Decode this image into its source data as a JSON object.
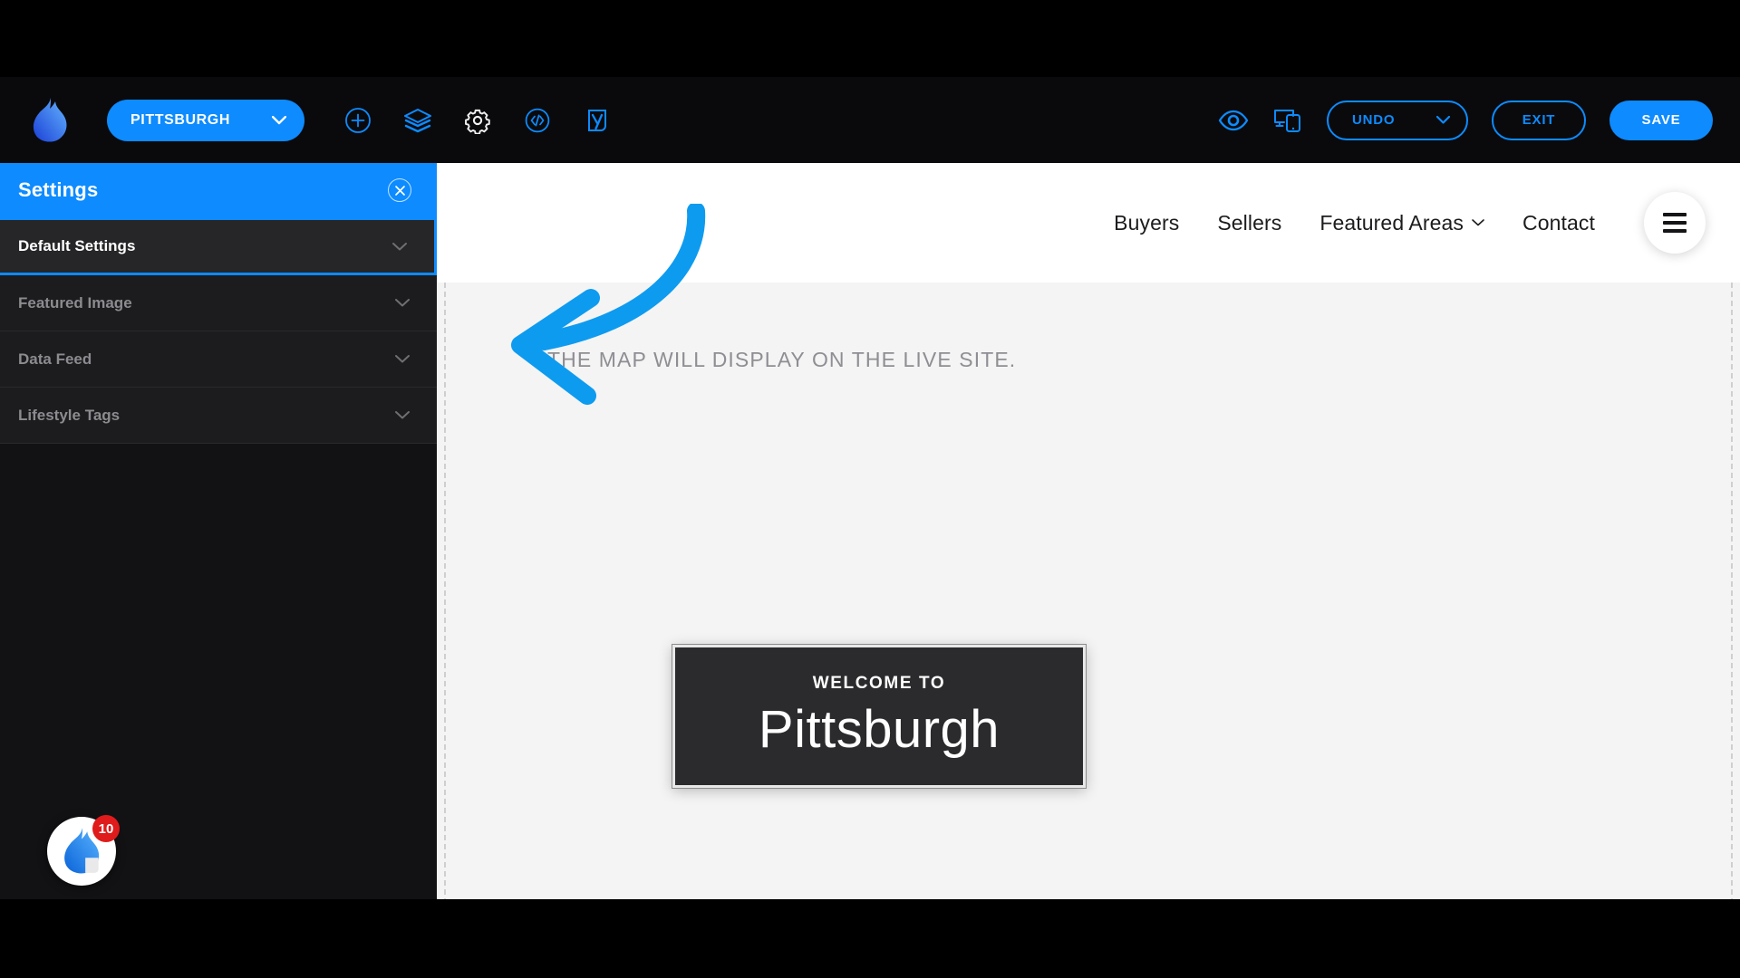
{
  "app": {
    "logo_icon": "flame-logo",
    "city_selector": {
      "label": "PITTSBURGH",
      "chevron_icon": "chevron-down-icon"
    },
    "toolbar_icons": [
      {
        "name": "add-element-icon",
        "label": "Add"
      },
      {
        "name": "layers-icon",
        "label": "Layers"
      },
      {
        "name": "settings-gear-icon",
        "label": "Settings"
      },
      {
        "name": "code-icon",
        "label": "Code"
      },
      {
        "name": "yoast-seo-icon",
        "label": "Yoast SEO"
      }
    ],
    "right_icons": [
      {
        "name": "preview-eye-icon",
        "label": "Preview"
      },
      {
        "name": "responsive-device-icon",
        "label": "Responsive"
      }
    ],
    "undo_label": "UNDO",
    "undo_chevron_icon": "chevron-down-icon",
    "exit_label": "EXIT",
    "save_label": "SAVE"
  },
  "sidebar": {
    "title": "Settings",
    "close_icon": "close-circle-icon",
    "items": [
      {
        "label": "Default Settings",
        "active": true,
        "chevron_icon": "chevron-down-icon"
      },
      {
        "label": "Featured Image",
        "active": false,
        "chevron_icon": "chevron-down-icon"
      },
      {
        "label": "Data Feed",
        "active": false,
        "chevron_icon": "chevron-down-icon"
      },
      {
        "label": "Lifestyle Tags",
        "active": false,
        "chevron_icon": "chevron-down-icon"
      }
    ],
    "chat_widget": {
      "icon": "flame-chat-icon",
      "badge_count": "10"
    }
  },
  "site_preview": {
    "nav_links": [
      {
        "label": "Buyers",
        "has_dropdown": false
      },
      {
        "label": "Sellers",
        "has_dropdown": false
      },
      {
        "label": "Featured Areas",
        "has_dropdown": true
      },
      {
        "label": "Contact",
        "has_dropdown": false
      }
    ],
    "menu_icon": "hamburger-menu-icon",
    "map_placeholder": "THE MAP WILL DISPLAY ON THE LIVE SITE.",
    "welcome_card": {
      "eyebrow": "WELCOME TO",
      "city": "Pittsburgh"
    }
  },
  "annotation": {
    "icon": "curved-arrow-left-icon",
    "color": "#0d9bf0"
  },
  "colors": {
    "accent_blue": "#0d8bff",
    "toolbar_bg": "#0a0a0c",
    "sidebar_bg": "#121214",
    "badge_red": "#e01b1b"
  }
}
